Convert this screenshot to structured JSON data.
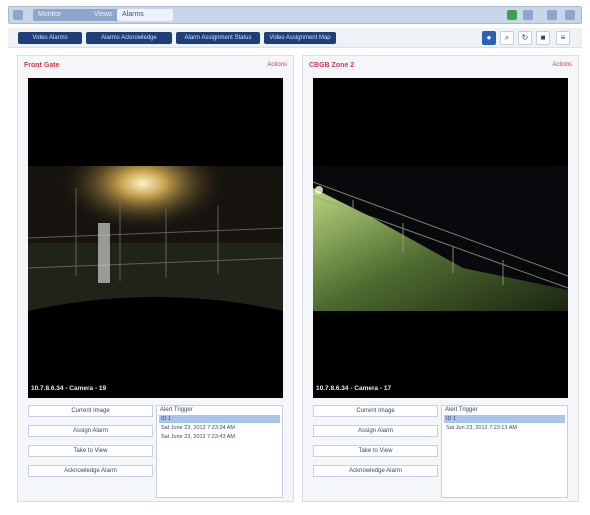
{
  "app": {
    "window_tabs": [
      "Monitor",
      "Views",
      "Alarms"
    ],
    "active_tab_index": 2
  },
  "toolbar": {
    "nav_buttons": [
      "Video Alarms",
      "Alarms Acknowledge",
      "Alarm Assignment Status",
      "Video Assignment Map"
    ],
    "tools": [
      {
        "icon": "user-icon",
        "glyph": "●"
      },
      {
        "icon": "search-icon",
        "glyph": "⌕"
      },
      {
        "icon": "refresh-icon",
        "glyph": "↻"
      },
      {
        "icon": "camera-icon",
        "glyph": "■"
      },
      {
        "icon": "menu-icon",
        "glyph": "≡"
      }
    ]
  },
  "panels": [
    {
      "title": "Front Gate",
      "link": "Actions",
      "camera_label": "10.7.8.6.34 - Camera - 19",
      "buttons": [
        "Current Image",
        "Assign Alarm",
        "Take to View",
        "Acknowledge Alarm"
      ],
      "alerts_label": "Alert Trigger",
      "alerts": [
        "ID 1",
        "Sat June 23, 2012 7:23:34 AM",
        "Sat June 23, 2012 7:23:43 AM"
      ]
    },
    {
      "title": "CBGB Zone 2",
      "link": "Actions",
      "camera_label": "10.7.8.6.34 - Camera - 17",
      "buttons": [
        "Current Image",
        "Assign Alarm",
        "Take to View",
        "Acknowledge Alarm"
      ],
      "alerts_label": "Alert Trigger",
      "alerts": [
        "ID 1",
        "Sat Jun 23, 2012 7:23:13 AM"
      ]
    }
  ]
}
